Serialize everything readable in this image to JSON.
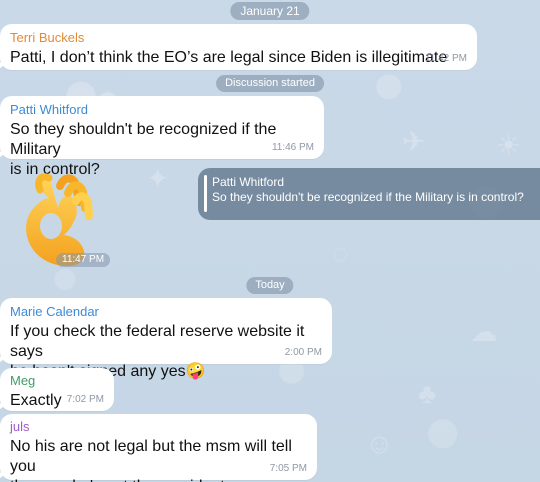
{
  "chat": {
    "date_top": "January 21",
    "discussion_started": "Discussion started",
    "date_bottom": "Today"
  },
  "messages": [
    {
      "sender": "Terri Buckels",
      "text": "Patti, I don’t think the EO’s are legal since Biden is illegitimate",
      "time": "11:42 PM",
      "sender_color": "#e48b37"
    },
    {
      "sender": "Patti Whitford",
      "text": "So they shouldn't be recognized if the Military\nis in control?",
      "time": "11:46 PM",
      "sender_color": "#3a8bd8"
    },
    {
      "reply_sender": "Patti Whitford",
      "reply_text": "So they shouldn't be recognized if the Military is in control?",
      "emoji_time": "11:47 PM"
    },
    {
      "sender": "Marie Calendar",
      "text": "If you check the federal reserve website it says\nhe hasn't signed any yes",
      "time": "2:00 PM",
      "sender_color": "#3a8bd8",
      "emoji": "🤪"
    },
    {
      "sender": "Meg",
      "text": "Exactly",
      "time": "7:02 PM",
      "sender_color": "#3f9e66"
    },
    {
      "sender": "juls",
      "text": "No his are not legal but the msm will tell you\nthey are he's not the president.",
      "time": "7:05 PM",
      "sender_color": "#9f5dc7"
    }
  ],
  "icons": [
    "background-pattern-icon",
    "ok-hand-icon"
  ]
}
